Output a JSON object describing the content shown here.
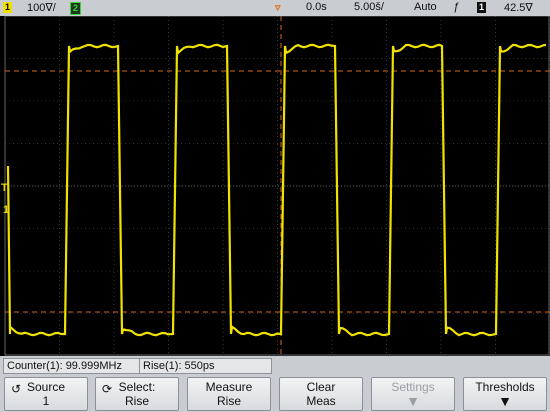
{
  "top_bar": {
    "channel1_number": "1",
    "channel1_scale": "100∇/",
    "channel2_number": "2",
    "time_offset": "0.0s",
    "time_scale": "5.00š/",
    "trigger_mode": "Auto",
    "trigger_slope_icon": "rising-edge-icon",
    "trigger_source": "1",
    "trigger_level": "42.5∇"
  },
  "markers": {
    "trigger_level": "T",
    "ground_channel1": "1"
  },
  "status": {
    "counter": "Counter(1): 99.999MHz",
    "rise": "Rise(1): 550ps"
  },
  "softkeys": [
    {
      "line1": "Source",
      "line2": "1",
      "icon": "return-arrow-icon",
      "disabled": false
    },
    {
      "line1": "Select:",
      "line2": "Rise",
      "icon": "rotate-icon",
      "disabled": false
    },
    {
      "line1": "Measure",
      "line2": "Rise",
      "icon": "",
      "disabled": false
    },
    {
      "line1": "Clear",
      "line2": "Meas",
      "icon": "",
      "disabled": false
    },
    {
      "line1": "Settings",
      "line2": "",
      "icon": "down-arrow-icon",
      "disabled": true
    },
    {
      "line1": "Thresholds",
      "line2": "",
      "icon": "down-arrow-icon",
      "disabled": false
    }
  ],
  "colors": {
    "trace": "#f0e200",
    "grid": "#5a5a5a",
    "cursor": "#d06a20",
    "channel1": "#f0e200",
    "channel2": "#3dd040",
    "trigger_marker": "#e07020"
  }
}
